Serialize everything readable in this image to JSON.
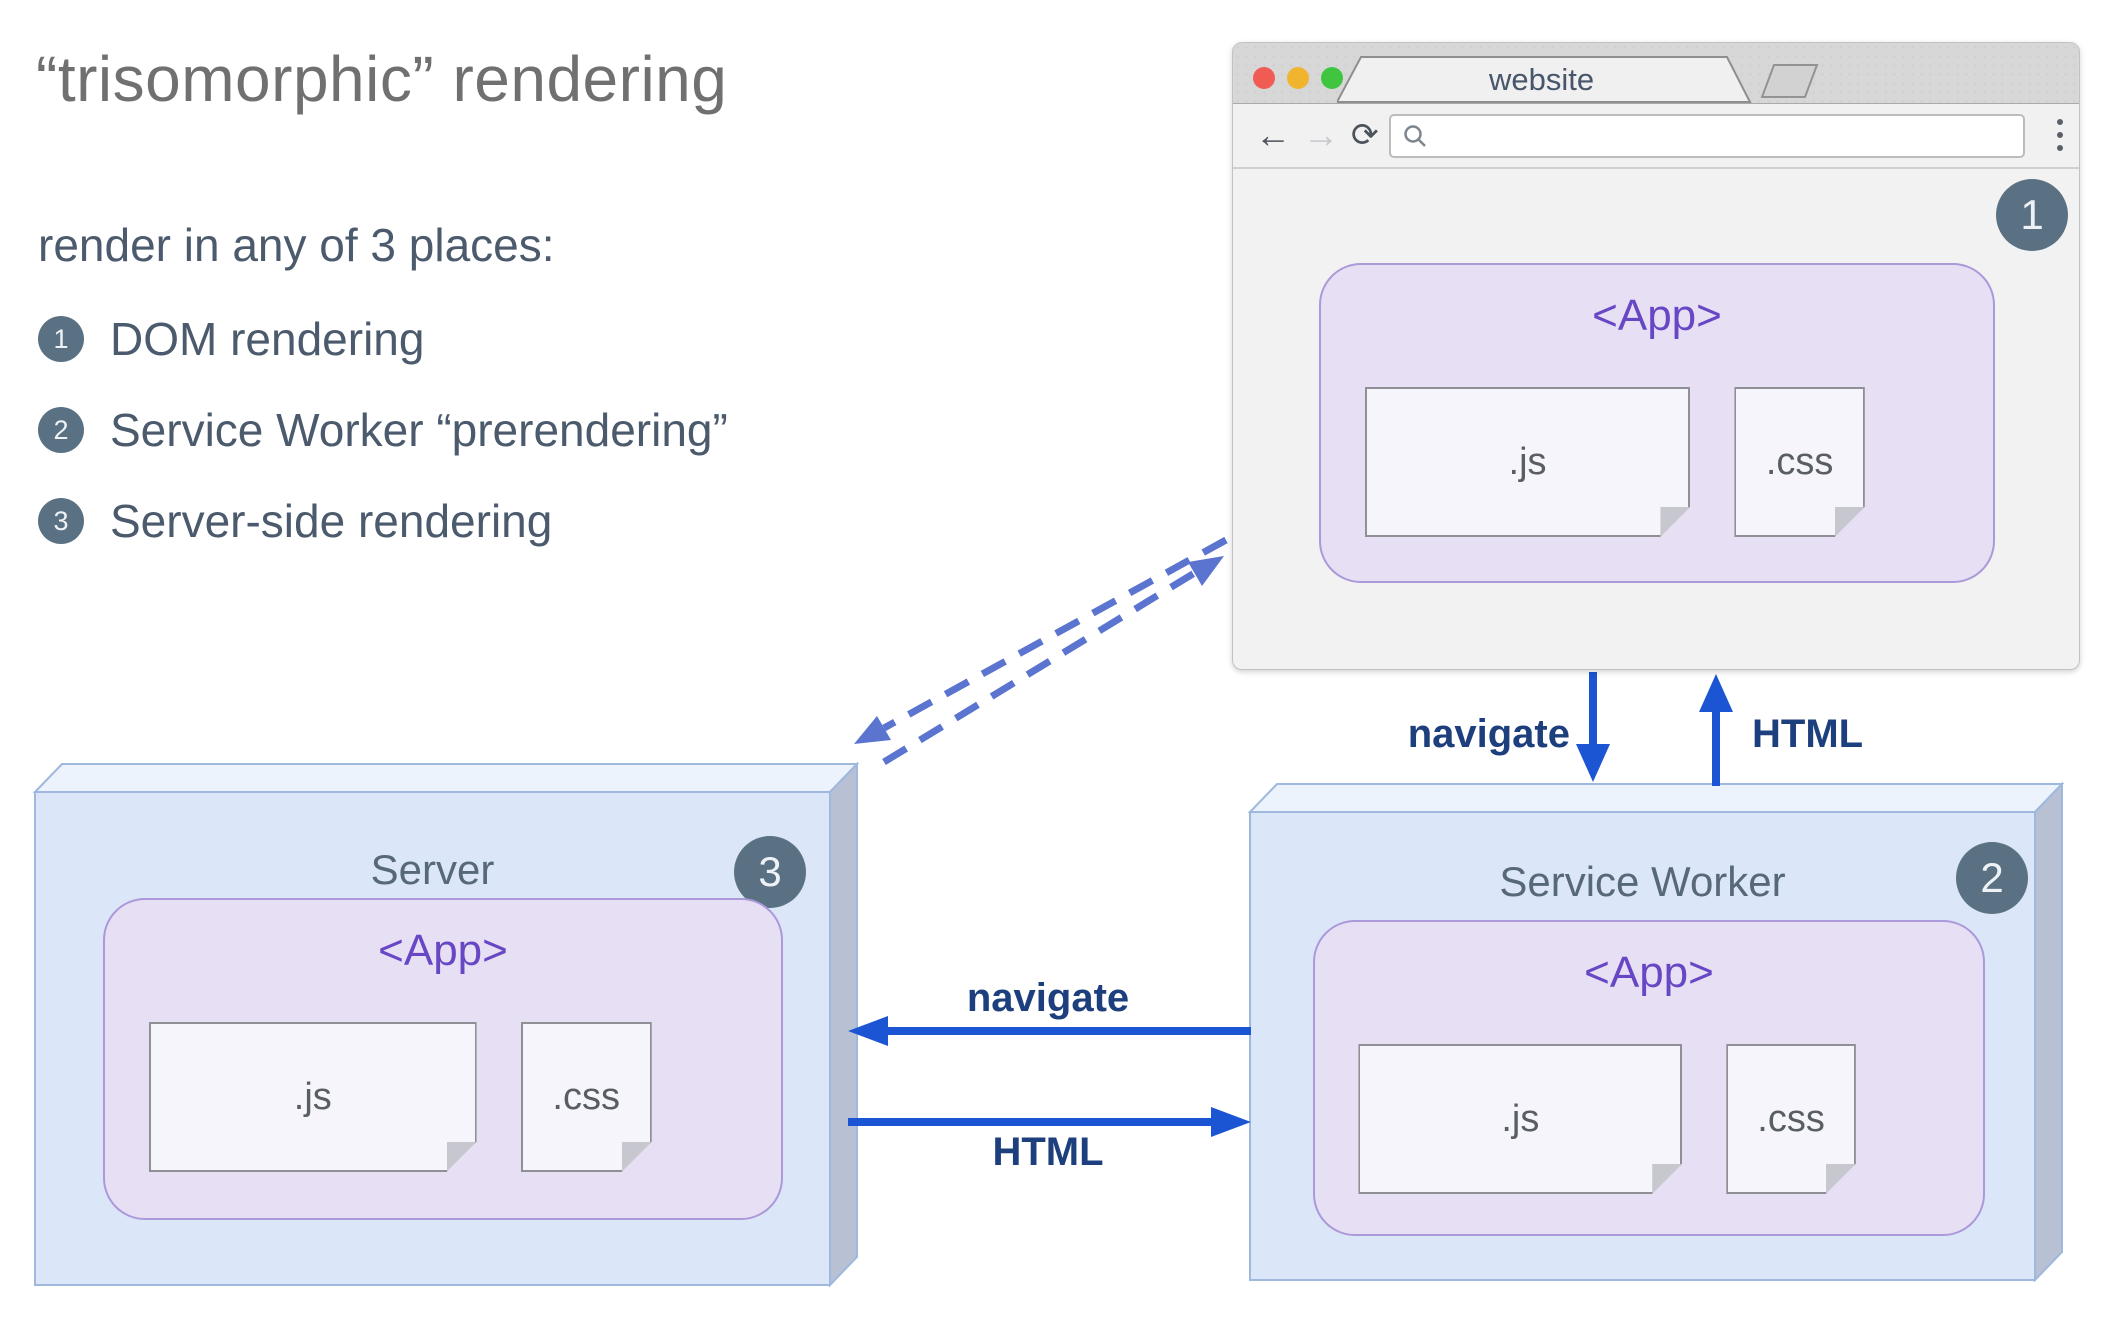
{
  "heading": {
    "title": "“trisomorphic” rendering",
    "subtitle": "render in any of 3 places:",
    "items": [
      {
        "num": "1",
        "label": "DOM rendering"
      },
      {
        "num": "2",
        "label": "Service Worker “prerendering”"
      },
      {
        "num": "3",
        "label": "Server-side rendering"
      }
    ]
  },
  "browser": {
    "tab_title": "website",
    "badge": "1",
    "url_value": "",
    "app": {
      "title": "<App>",
      "js": ".js",
      "css": ".css"
    }
  },
  "server": {
    "title": "Server",
    "badge": "3",
    "app": {
      "title": "<App>",
      "js": ".js",
      "css": ".css"
    }
  },
  "service_worker": {
    "title": "Service Worker",
    "badge": "2",
    "app": {
      "title": "<App>",
      "js": ".js",
      "css": ".css"
    }
  },
  "arrows": {
    "browser_to_sw": "navigate",
    "sw_to_browser": "HTML",
    "sw_to_server": "navigate",
    "server_to_sw": "HTML"
  },
  "icons": {
    "back": "←",
    "forward": "→",
    "refresh": "⟳"
  },
  "colors": {
    "solid_arrow": "#1b55d3",
    "dashed_arrow": "#5b74cf",
    "arrow_label": "#1e3f7e",
    "badge_bg": "#5a7183",
    "app_accent": "#6847c5",
    "box_face": "#dbe7f8",
    "box_top": "#edf3fc",
    "box_side": "#b7c1d3",
    "app_face": "#e7e0f4",
    "traffic_red": "#f05b54",
    "traffic_yellow": "#f1b42f",
    "traffic_green": "#3fc540"
  }
}
